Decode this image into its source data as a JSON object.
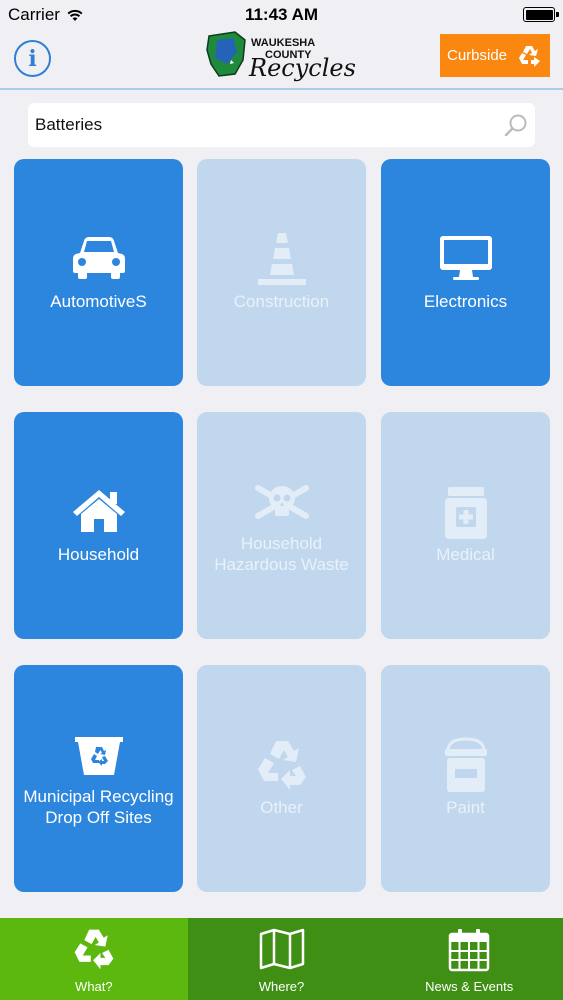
{
  "status_bar": {
    "carrier": "Carrier",
    "time": "11:43 AM"
  },
  "header": {
    "logo": {
      "line1": "WAUKESHA",
      "line2": "COUNTY",
      "line3": "Recycles"
    },
    "curbside_label": "Curbside"
  },
  "search": {
    "value": "Batteries"
  },
  "categories": [
    {
      "label": "AutomotiveS",
      "enabled": true,
      "icon": "car-icon"
    },
    {
      "label": "Construction",
      "enabled": false,
      "icon": "traffic-cone-icon"
    },
    {
      "label": "Electronics",
      "enabled": true,
      "icon": "monitor-icon"
    },
    {
      "label": "Household",
      "enabled": true,
      "icon": "house-icon"
    },
    {
      "label": "Household\nHazardous Waste",
      "line1": "Household",
      "line2": "Hazardous Waste",
      "enabled": false,
      "icon": "skull-crossbones-icon"
    },
    {
      "label": "Medical",
      "enabled": false,
      "icon": "medicine-bottle-icon"
    },
    {
      "label": "Municipal Recycling Drop Off Sites",
      "line1": "Municipal Recycling",
      "line2": "Drop Off Sites",
      "enabled": true,
      "icon": "recycle-bin-icon"
    },
    {
      "label": "Other",
      "enabled": false,
      "icon": "recycle-icon"
    },
    {
      "label": "Paint",
      "enabled": false,
      "icon": "paint-can-icon"
    }
  ],
  "tab_bar": {
    "tabs": [
      {
        "label": "What?",
        "selected": true,
        "icon": "recycle-icon"
      },
      {
        "label": "Where?",
        "selected": false,
        "icon": "map-icon"
      },
      {
        "label": "News & Events",
        "selected": false,
        "icon": "calendar-icon"
      }
    ]
  },
  "colors": {
    "active_tile": "#2d86de",
    "inactive_tile": "#c0d7ee",
    "curbside": "#f98710",
    "tab_bar": "#3f8f15",
    "tab_selected": "#5cb80e",
    "accent": "#2f7fd6"
  }
}
